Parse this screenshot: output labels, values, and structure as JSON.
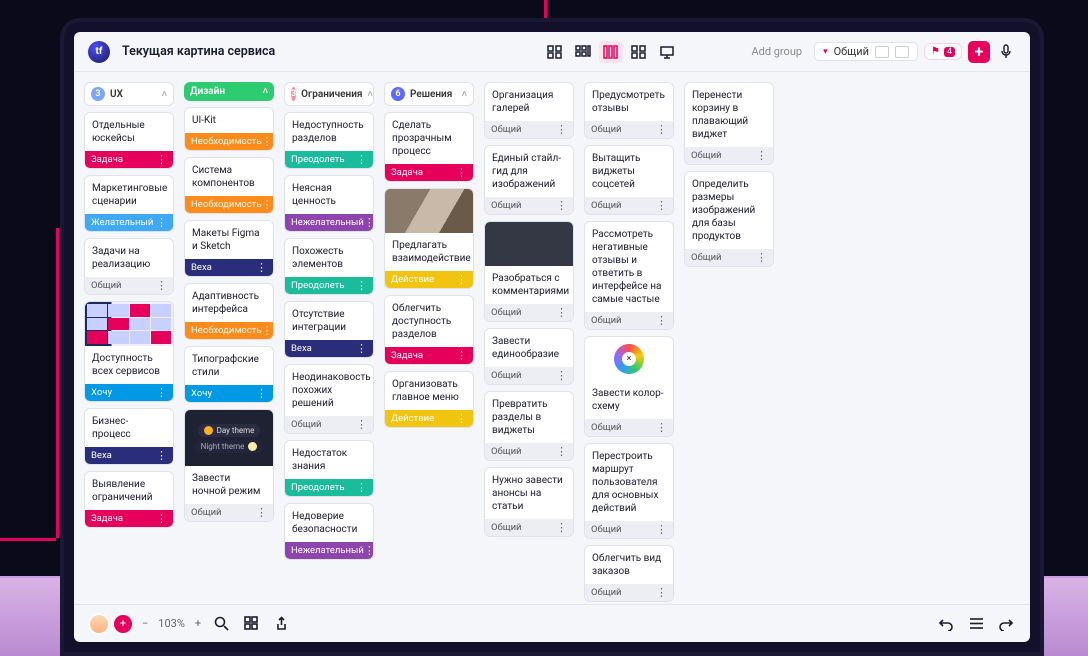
{
  "header": {
    "logo": "tf",
    "title": "Текущая картина сервиса",
    "add_group": "Add group",
    "filter_label": "Общий",
    "flag_count": "4"
  },
  "tag_colors": {
    "task": "#e6005c",
    "want": "#0099e6",
    "milestone": "#2a2d7a",
    "need": "#ff8c1a",
    "overcome": "#1abc9c",
    "unwanted": "#8e44ad",
    "action": "#f1c40f",
    "common": "#eceef4"
  },
  "tag_labels": {
    "task": "Задача",
    "want": "Хочу",
    "wanted": "Желательный",
    "milestone": "Веха",
    "need": "Необходимость",
    "overcome": "Преодолеть",
    "unwanted": "Нежелательный",
    "action": "Действие",
    "common": "Общий"
  },
  "columns": [
    {
      "id": "ux",
      "badge": "3",
      "badge_color": "#7aa8ff",
      "title": "UX",
      "cards": [
        {
          "text": "Отдельные юскейсы",
          "tag": "task"
        },
        {
          "text": "Маркетинговые сценарии",
          "tag": "wanted",
          "tag_color": "#3fa9f5"
        },
        {
          "text": "Задачи на реализацию",
          "tag": "common"
        },
        {
          "thumb": "grid",
          "text": "Доступность всех сервисов",
          "tag": "want"
        },
        {
          "text": "Бизнес-процесс",
          "tag": "milestone"
        },
        {
          "text": "Выявление ограничений",
          "tag": "task"
        }
      ]
    },
    {
      "id": "design",
      "badge": "",
      "badge_color": "#2ecc71",
      "title": "Дизайн",
      "title_is_tag": true,
      "cards": [
        {
          "text": "UI-Kit",
          "tag": "need"
        },
        {
          "text": "Система компонентов",
          "tag": "need"
        },
        {
          "text": "Макеты Figma и Sketch",
          "tag": "milestone"
        },
        {
          "text": "Адаптивность интерфейса",
          "tag": "need"
        },
        {
          "text": "Типографские стили",
          "tag": "want"
        },
        {
          "thumb": "dark",
          "text": "Завести ночной режим",
          "tag": "common"
        }
      ]
    },
    {
      "id": "limits",
      "badge": "3",
      "badge_color": "#ff8c9e",
      "title": "Ограничения",
      "cards": [
        {
          "text": "Недоступность разделов",
          "tag": "overcome"
        },
        {
          "text": "Неясная ценность",
          "tag": "unwanted"
        },
        {
          "text": "Похожесть элементов",
          "tag": "overcome"
        },
        {
          "text": "Отсутствие интеграции",
          "tag": "milestone"
        },
        {
          "text": "Неодинаковость похожих решений",
          "tag": "common"
        },
        {
          "text": "Недостаток знания",
          "tag": "overcome"
        },
        {
          "text": "Недоверие безопасности",
          "tag": "unwanted"
        }
      ]
    },
    {
      "id": "solutions",
      "badge": "6",
      "badge_color": "#5b6bff",
      "title": "Решения",
      "cards": [
        {
          "text": "Сделать прозрачным процесс",
          "tag": "task"
        },
        {
          "thumb": "photo",
          "text": "Предлагать взаимодействие",
          "tag": "action"
        },
        {
          "text": "Облегчить доступность разделов",
          "tag": "task"
        },
        {
          "text": "Организовать главное меню",
          "tag": "action"
        }
      ]
    },
    {
      "id": "c5",
      "plain": true,
      "cards": [
        {
          "text": "Организация галерей",
          "tag": "common"
        },
        {
          "text": "Единый стайл-гид для изображений",
          "tag": "common"
        },
        {
          "thumb": "video",
          "text": "Разобраться с комментариями",
          "tag": "common"
        },
        {
          "text": "Завести единообразие",
          "tag": "common"
        },
        {
          "text": "Превратить разделы в виджеты",
          "tag": "common"
        },
        {
          "text": "Нужно завести анонсы на статьи",
          "tag": "common"
        }
      ]
    },
    {
      "id": "c6",
      "plain": true,
      "cards": [
        {
          "text": "Предусмотреть отзывы",
          "tag": "common"
        },
        {
          "text": "Вытащить виджеты соцсетей",
          "tag": "common"
        },
        {
          "text": "Рассмотреть негативные отзывы и ответить в интерфейсе на самые частые",
          "tag": "common"
        },
        {
          "thumb": "wheel",
          "text": "Завести колор-схему",
          "tag": "common"
        },
        {
          "text": "Перестроить маршрут пользователя для основных действий",
          "tag": "common"
        },
        {
          "text": "Облегчить вид заказов",
          "tag": "common"
        }
      ]
    },
    {
      "id": "c7",
      "plain": true,
      "cards": [
        {
          "text": "Перенести корзину в плавающий виджет",
          "tag": "common"
        },
        {
          "text": "Определить размеры изображений для базы продуктов",
          "tag": "common"
        }
      ]
    }
  ],
  "themes": {
    "day": "Day theme",
    "night": "Night theme"
  },
  "zoom": "103%"
}
